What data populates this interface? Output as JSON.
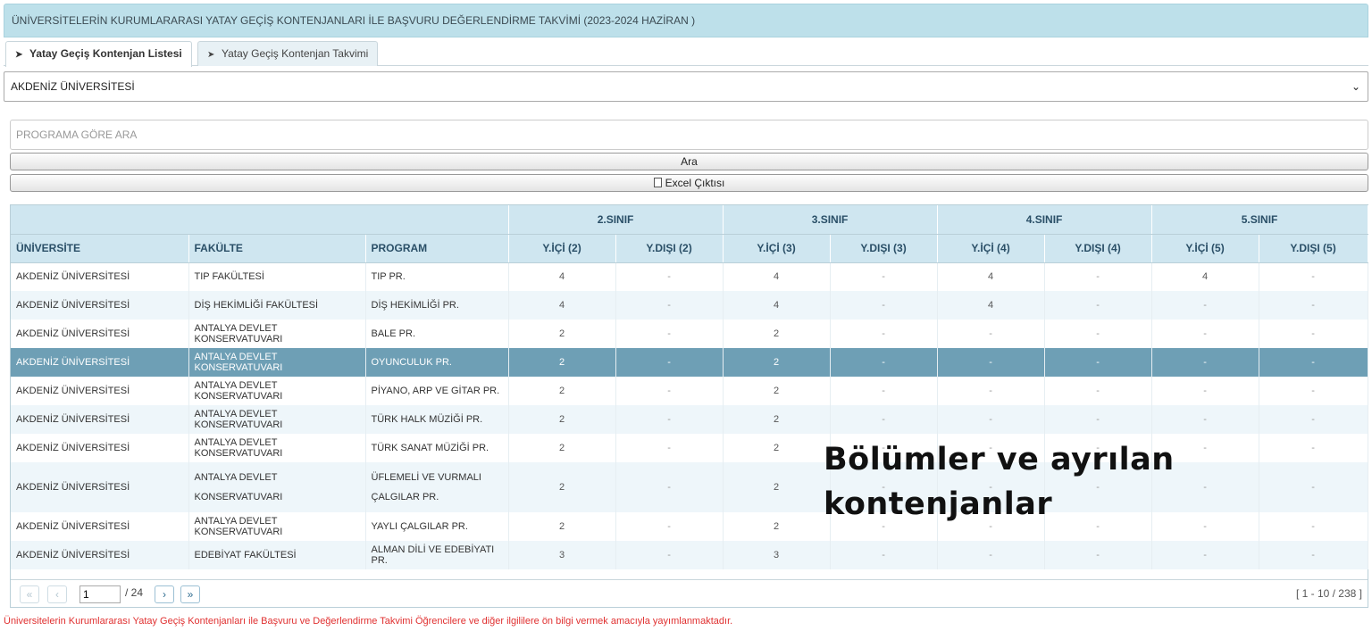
{
  "header": {
    "title": "ÜNİVERSİTELERİN KURUMLARARASI YATAY GEÇİŞ KONTENJANLARI İLE BAŞVURU DEĞERLENDİRME TAKVİMİ (2023-2024 HAZİRAN )"
  },
  "tabs": [
    {
      "label": "Yatay Geçiş Kontenjan Listesi",
      "active": true,
      "icon": "tag-icon"
    },
    {
      "label": "Yatay Geçiş Kontenjan Takvimi",
      "active": false,
      "icon": "tag-icon"
    }
  ],
  "filters": {
    "university_selected": "AKDENİZ ÜNİVERSİTESİ",
    "search_placeholder": "PROGRAMA GÖRE ARA",
    "search_button": "Ara",
    "excel_button": "Excel Çıktısı"
  },
  "table": {
    "group_headers": [
      "2.SINIF",
      "3.SINIF",
      "4.SINIF",
      "5.SINIF"
    ],
    "columns": [
      "ÜNİVERSİTE",
      "FAKÜLTE",
      "PROGRAM",
      "Y.İÇİ (2)",
      "Y.DIŞI (2)",
      "Y.İÇİ (3)",
      "Y.DIŞI (3)",
      "Y.İÇİ (4)",
      "Y.DIŞI (4)",
      "Y.İÇİ (5)",
      "Y.DIŞI (5)"
    ],
    "rows": [
      [
        "AKDENİZ ÜNİVERSİTESİ",
        "TIP FAKÜLTESİ",
        "TIP PR.",
        "4",
        "-",
        "4",
        "-",
        "4",
        "-",
        "4",
        "-"
      ],
      [
        "AKDENİZ ÜNİVERSİTESİ",
        "DİŞ HEKİMLİĞİ FAKÜLTESİ",
        "DİŞ HEKİMLİĞİ PR.",
        "4",
        "-",
        "4",
        "-",
        "4",
        "-",
        "-",
        "-"
      ],
      [
        "AKDENİZ ÜNİVERSİTESİ",
        "ANTALYA DEVLET KONSERVATUVARI",
        "BALE PR.",
        "2",
        "-",
        "2",
        "-",
        "-",
        "-",
        "-",
        "-"
      ],
      [
        "AKDENİZ ÜNİVERSİTESİ",
        "ANTALYA DEVLET KONSERVATUVARI",
        "OYUNCULUK PR.",
        "2",
        "-",
        "2",
        "-",
        "-",
        "-",
        "-",
        "-"
      ],
      [
        "AKDENİZ ÜNİVERSİTESİ",
        "ANTALYA DEVLET KONSERVATUVARI",
        "PİYANO, ARP VE GİTAR PR.",
        "2",
        "-",
        "2",
        "-",
        "-",
        "-",
        "-",
        "-"
      ],
      [
        "AKDENİZ ÜNİVERSİTESİ",
        "ANTALYA DEVLET KONSERVATUVARI",
        "TÜRK HALK MÜZİĞİ PR.",
        "2",
        "-",
        "2",
        "-",
        "-",
        "-",
        "-",
        "-"
      ],
      [
        "AKDENİZ ÜNİVERSİTESİ",
        "ANTALYA DEVLET KONSERVATUVARI",
        "TÜRK SANAT MÜZİĞİ PR.",
        "2",
        "-",
        "2",
        "-",
        "-",
        "-",
        "-",
        "-"
      ],
      [
        "AKDENİZ ÜNİVERSİTESİ",
        "ANTALYA DEVLET KONSERVATUVARI",
        "ÜFLEMELİ VE VURMALI ÇALGILAR PR.",
        "2",
        "-",
        "2",
        "-",
        "-",
        "-",
        "-",
        "-"
      ],
      [
        "AKDENİZ ÜNİVERSİTESİ",
        "ANTALYA DEVLET KONSERVATUVARI",
        "YAYLI ÇALGILAR PR.",
        "2",
        "-",
        "2",
        "-",
        "-",
        "-",
        "-",
        "-"
      ],
      [
        "AKDENİZ ÜNİVERSİTESİ",
        "EDEBİYAT FAKÜLTESİ",
        "ALMAN DİLİ VE EDEBİYATI PR.",
        "3",
        "-",
        "3",
        "-",
        "-",
        "-",
        "-",
        "-"
      ]
    ],
    "selected_row_index": 3
  },
  "pagination": {
    "current_page": "1",
    "total_label": "/ 24",
    "range_label": "[ 1 - 10 / 238 ]"
  },
  "overlay": {
    "line1": "Bölümler ve ayrılan",
    "line2": "kontenjanlar"
  },
  "footer": {
    "note": "Üniversitelerin Kurumlararası Yatay Geçiş Kontenjanları ile Başvuru ve Değerlendirme Takvimi Öğrencilere ve diğer ilgililere ön bilgi vermek amacıyla yayımlanmaktadır."
  },
  "colors": {
    "header_bg": "#bde0ea",
    "table_header_bg": "#cfe6f0",
    "selected_row_bg": "#6e9fb5",
    "footer_text": "#e03030"
  }
}
